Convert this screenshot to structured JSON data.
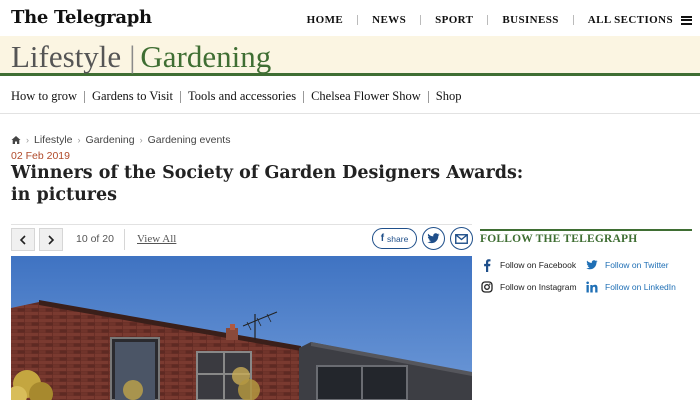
{
  "header": {
    "logo": "The Telegraph",
    "nav": [
      "HOME",
      "NEWS",
      "SPORT",
      "BUSINESS",
      "ALL SECTIONS"
    ]
  },
  "section": {
    "parent": "Lifestyle",
    "child": "Gardening",
    "accent_color": "#3f6e33",
    "banner_color": "#fbf5e2"
  },
  "subnav": [
    "How to grow",
    "Gardens to Visit",
    "Tools and accessories",
    "Chelsea Flower Show",
    "Shop"
  ],
  "breadcrumb": [
    "Lifestyle",
    "Gardening",
    "Gardening events"
  ],
  "article": {
    "date": "02 Feb 2019",
    "title_line1": "Winners of the Society of Garden Designers Awards:",
    "title_line2": "in pictures"
  },
  "gallery": {
    "prev_icon": "chevron-left-icon",
    "next_icon": "chevron-right-icon",
    "counter": "10 of 20",
    "view_all": "View All",
    "share_label": "share"
  },
  "follow": {
    "heading": "FOLLOW THE TELEGRAPH",
    "links": [
      {
        "label": "Follow on Facebook",
        "icon": "facebook-icon"
      },
      {
        "label": "Follow on Twitter",
        "icon": "twitter-icon"
      },
      {
        "label": "Follow on Instagram",
        "icon": "instagram-icon"
      },
      {
        "label": "Follow on LinkedIn",
        "icon": "linkedin-icon"
      }
    ]
  }
}
